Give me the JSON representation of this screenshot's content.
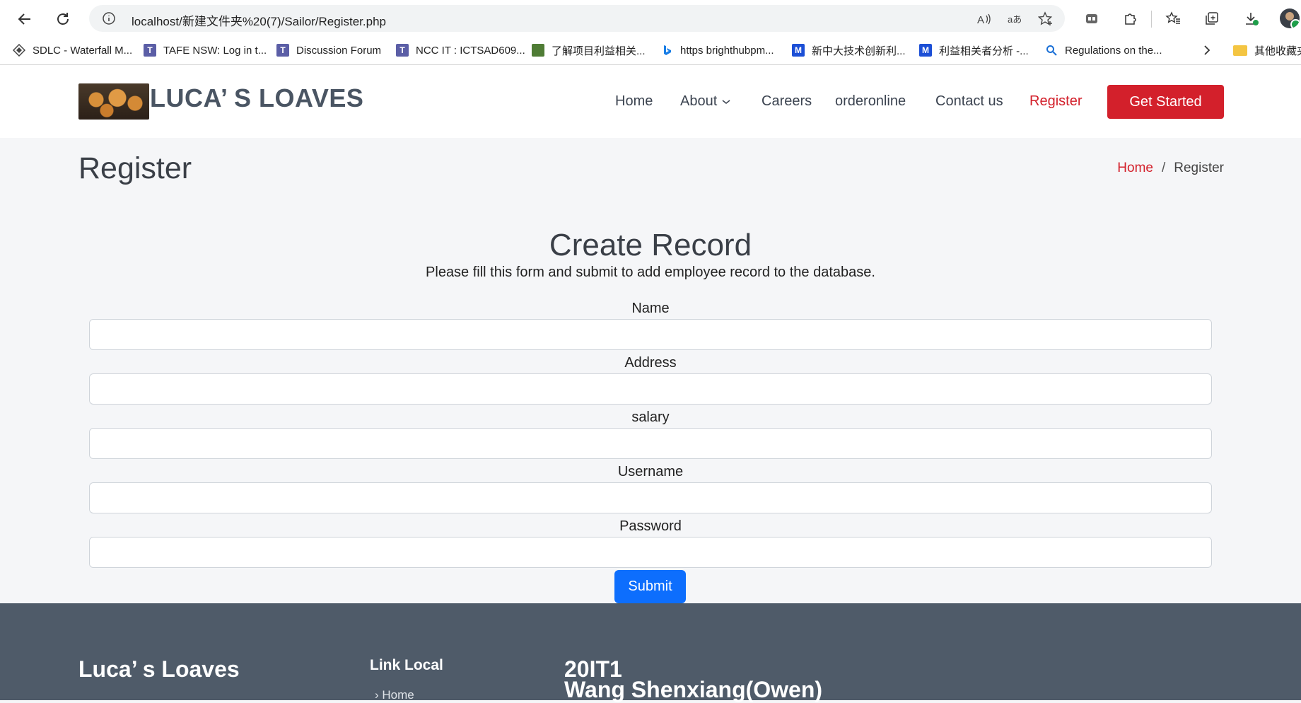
{
  "browser": {
    "url": "localhost/新建文件夹%20(7)/Sailor/Register.php",
    "bookmarks": [
      {
        "label": "SDLC - Waterfall M...",
        "icon": "diamond-icon"
      },
      {
        "label": "TAFE NSW: Log in t...",
        "icon": "t-logo-icon"
      },
      {
        "label": "Discussion Forum",
        "icon": "t-logo-icon"
      },
      {
        "label": "NCC IT : ICTSAD609...",
        "icon": "t-logo-icon"
      },
      {
        "label": "了解项目利益相关...",
        "icon": "image-icon"
      },
      {
        "label": "https brighthubpm...",
        "icon": "bing-icon"
      },
      {
        "label": "新中大技术创新利...",
        "icon": "m-logo-icon"
      },
      {
        "label": "利益相关者分析 -...",
        "icon": "m-logo-icon"
      },
      {
        "label": "Regulations on the...",
        "icon": "search-icon"
      }
    ],
    "other_favorites": "其他收藏夹"
  },
  "site": {
    "logo_text": "LUCA’ S LOAVES",
    "nav": {
      "home": "Home",
      "about": "About",
      "careers": "Careers",
      "orderonline": "orderonline",
      "contact": "Contact us",
      "register": "Register"
    },
    "cta": "Get Started"
  },
  "page": {
    "title": "Register",
    "breadcrumb": {
      "home": "Home",
      "sep": "/",
      "current": "Register"
    }
  },
  "form": {
    "title": "Create Record",
    "subtitle": "Please fill this form and submit to add employee record to the database.",
    "fields": [
      {
        "label": "Name",
        "value": ""
      },
      {
        "label": "Address",
        "value": ""
      },
      {
        "label": "salary",
        "value": ""
      },
      {
        "label": "Username",
        "value": ""
      },
      {
        "label": "Password",
        "value": ""
      }
    ],
    "submit": "Submit"
  },
  "footer": {
    "brand": "Luca’ s Loaves",
    "links_heading": "Link Local",
    "links": [
      "Home"
    ],
    "class_id": "20IT1",
    "author": "Wang Shenxiang(Owen)"
  },
  "colors": {
    "accent_red": "#d3202b",
    "submit_blue": "#0d6efd",
    "footer_bg": "#4f5b69"
  }
}
